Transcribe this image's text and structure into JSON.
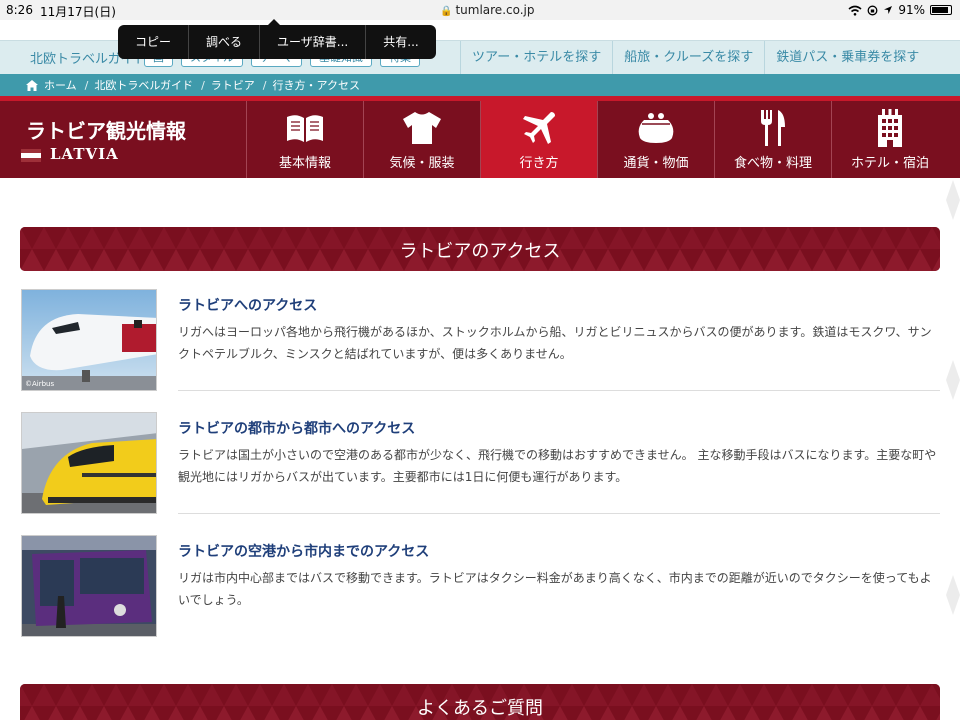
{
  "status_bar": {
    "time": "8:26",
    "date": "11月17日(日)",
    "url": "tumlare.co.jp",
    "battery": "91%",
    "battery_level": 0.91
  },
  "selection_menu": {
    "items": [
      "コピー",
      "調べる",
      "ユーザ辞書...",
      "共有..."
    ]
  },
  "top_nav": {
    "brand": "北欧トラベルガイド",
    "pills": [
      "国",
      "スタイル",
      "テーマ",
      "基礎知識",
      "特集"
    ],
    "links": [
      "ツアー・ホテルを探す",
      "船旅・クルーズを探す",
      "鉄道パス・乗車券を探す"
    ]
  },
  "breadcrumb": [
    "ホーム",
    "北欧トラベルガイド",
    "ラトビア",
    "行き方・アクセス"
  ],
  "country": {
    "name": "ラトビア観光情報",
    "name_en": "LATVIA",
    "flag_colors": [
      "#9e3039",
      "#ffffff",
      "#9e3039"
    ]
  },
  "tabs": [
    {
      "label": "基本情報",
      "icon": "book-icon",
      "active": false
    },
    {
      "label": "気候・服装",
      "icon": "shirt-icon",
      "active": false
    },
    {
      "label": "行き方",
      "icon": "airplane-icon",
      "active": true
    },
    {
      "label": "通貨・物価",
      "icon": "purse-icon",
      "active": false
    },
    {
      "label": "食べ物・料理",
      "icon": "fork-knife-icon",
      "active": false
    },
    {
      "label": "ホテル・宿泊",
      "icon": "building-icon",
      "active": false
    }
  ],
  "access_section": {
    "title": "ラトビアのアクセス",
    "items": [
      {
        "title": "ラトビアへのアクセス",
        "description": "リガへはヨーロッパ各地から飛行機があるほか、ストックホルムから船、リガとビリニュスからバスの便があります。鉄道はモスクワ、サンクトペテルブルク、ミンスクと結ばれていますが、便は多くありません。",
        "image": "airplane-photo",
        "credit": "©Airbus"
      },
      {
        "title": "ラトビアの都市から都市へのアクセス",
        "description": "ラトビアは国土が小さいので空港のある都市が少なく、飛行機での移動はおすすめできません。 主な移動手段はバスになります。主要な町や観光地にはリガからバスが出ています。主要都市には1日に何便も運行があります。",
        "image": "train-photo"
      },
      {
        "title": "ラトビアの空港から市内までのアクセス",
        "description": "リガは市内中心部まではバスで移動できます。ラトビアはタクシー料金があまり高くなく、市内までの距離が近いのでタクシーを使ってもよいでしょう。",
        "image": "bus-photo"
      }
    ]
  },
  "faq_section": {
    "title": "よくあるご質問"
  },
  "colors": {
    "brand_red": "#7a0f1f",
    "active_red": "#c8182b",
    "breadcrumb_teal": "#3f9aab",
    "nav_bg": "#dcecef",
    "title_blue": "#1f3f7a"
  }
}
